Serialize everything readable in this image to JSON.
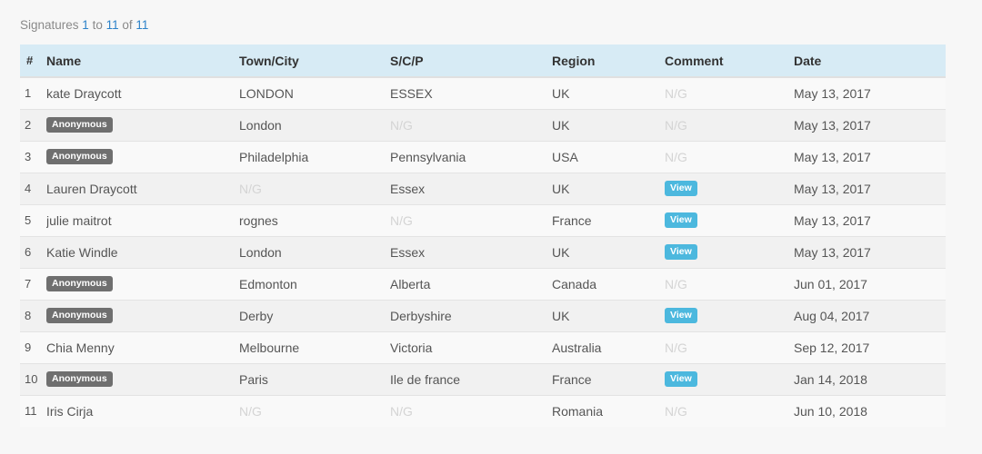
{
  "summary": {
    "prefix": "Signatures ",
    "from": "1",
    "to_word": " to ",
    "to": "11",
    "of_word": " of ",
    "total": "11"
  },
  "table": {
    "columns": [
      "#",
      "Name",
      "Town/City",
      "S/C/P",
      "Region",
      "Comment",
      "Date"
    ],
    "empty_value": "N/G",
    "rows": [
      {
        "num": "1",
        "name": "kate Draycott",
        "anonymous": false,
        "town": "LONDON",
        "scp": "ESSEX",
        "region": "UK",
        "comment": null,
        "date": "May 13, 2017"
      },
      {
        "num": "2",
        "name": "Anonymous",
        "anonymous": true,
        "town": "London",
        "scp": null,
        "region": "UK",
        "comment": null,
        "date": "May 13, 2017"
      },
      {
        "num": "3",
        "name": "Anonymous",
        "anonymous": true,
        "town": "Philadelphia",
        "scp": "Pennsylvania",
        "region": "USA",
        "comment": null,
        "date": "May 13, 2017"
      },
      {
        "num": "4",
        "name": "Lauren Draycott",
        "anonymous": false,
        "town": null,
        "scp": "Essex",
        "region": "UK",
        "comment": "View",
        "date": "May 13, 2017"
      },
      {
        "num": "5",
        "name": "julie maitrot",
        "anonymous": false,
        "town": "rognes",
        "scp": null,
        "region": "France",
        "comment": "View",
        "date": "May 13, 2017"
      },
      {
        "num": "6",
        "name": "Katie Windle",
        "anonymous": false,
        "town": "London",
        "scp": "Essex",
        "region": "UK",
        "comment": "View",
        "date": "May 13, 2017"
      },
      {
        "num": "7",
        "name": "Anonymous",
        "anonymous": true,
        "town": "Edmonton",
        "scp": "Alberta",
        "region": "Canada",
        "comment": null,
        "date": "Jun 01, 2017"
      },
      {
        "num": "8",
        "name": "Anonymous",
        "anonymous": true,
        "town": "Derby",
        "scp": "Derbyshire",
        "region": "UK",
        "comment": "View",
        "date": "Aug 04, 2017"
      },
      {
        "num": "9",
        "name": "Chia Menny",
        "anonymous": false,
        "town": "Melbourne",
        "scp": "Victoria",
        "region": "Australia",
        "comment": null,
        "date": "Sep 12, 2017"
      },
      {
        "num": "10",
        "name": "Anonymous",
        "anonymous": true,
        "town": "Paris",
        "scp": "Ile de france",
        "region": "France",
        "comment": "View",
        "date": "Jan 14, 2018"
      },
      {
        "num": "11",
        "name": "Iris Cirja",
        "anonymous": false,
        "town": null,
        "scp": null,
        "region": "Romania",
        "comment": null,
        "date": "Jun 10, 2018"
      }
    ]
  },
  "colors": {
    "header_bg": "#d7ebf5",
    "link": "#2c82c9",
    "anonymous_badge": "#6f6f6f",
    "view_badge": "#4cb8de",
    "placeholder_text": "#d4d4d4"
  }
}
